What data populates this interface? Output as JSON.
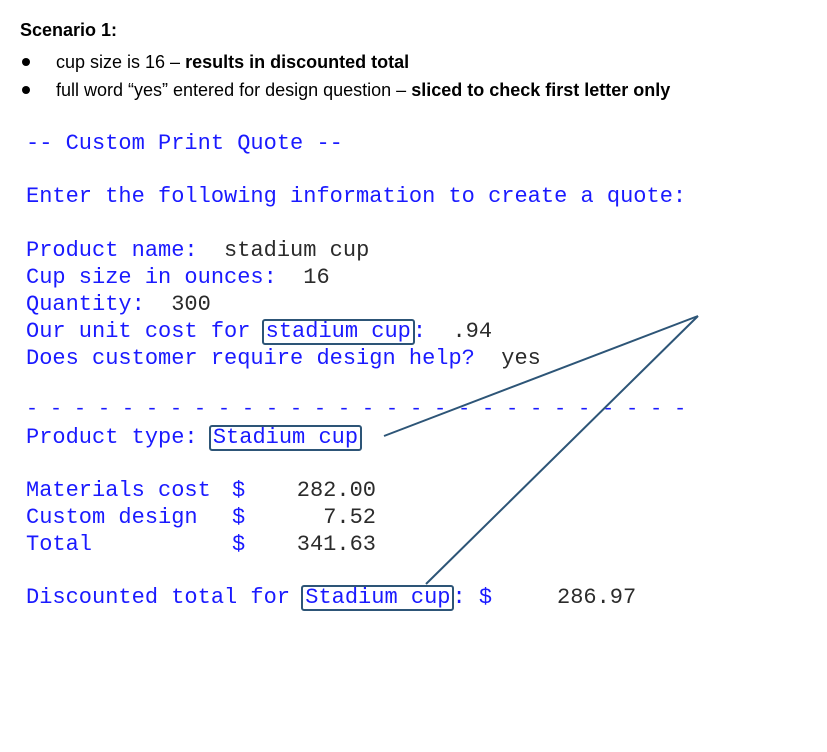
{
  "scenario": {
    "title": "Scenario 1:",
    "bullets": [
      {
        "normal": "cup size is 16 – ",
        "bold": "results in discounted total"
      },
      {
        "normal": "full word “yes” entered for design question – ",
        "bold": "sliced to check first letter only"
      }
    ]
  },
  "console": {
    "header": "-- Custom Print Quote --",
    "instructions": "Enter the following information to create a quote:",
    "product_name_label": "Product name:",
    "product_name_value": "stadium cup",
    "cup_size_label": "Cup size in ounces:",
    "cup_size_value": "16",
    "quantity_label": "Quantity:",
    "quantity_value": "300",
    "unit_cost_prefix": "Our unit cost for ",
    "unit_cost_product": "stadium cup",
    "unit_cost_suffix": ":",
    "unit_cost_value": ".94",
    "design_help_label": "Does customer require design help?",
    "design_help_value": "yes",
    "divider": "- - - - - - - - - - - - - - - - - - - - - - - - - - - -",
    "product_type_label": "Product type:",
    "product_type_value": "Stadium cup",
    "materials_label": "Materials cost",
    "materials_currency": "$",
    "materials_value": "282.00",
    "design_label": "Custom design",
    "design_currency": "$",
    "design_value": "7.52",
    "total_label": "Total",
    "total_currency": "$",
    "total_value": "341.63",
    "discount_prefix": "Discounted total for ",
    "discount_product": "Stadium cup",
    "discount_suffix": ": $",
    "discount_value": "286.97"
  },
  "colors": {
    "console_text": "#1a1aff",
    "user_input": "#2b2b2b",
    "annotation": "#2d5577"
  }
}
